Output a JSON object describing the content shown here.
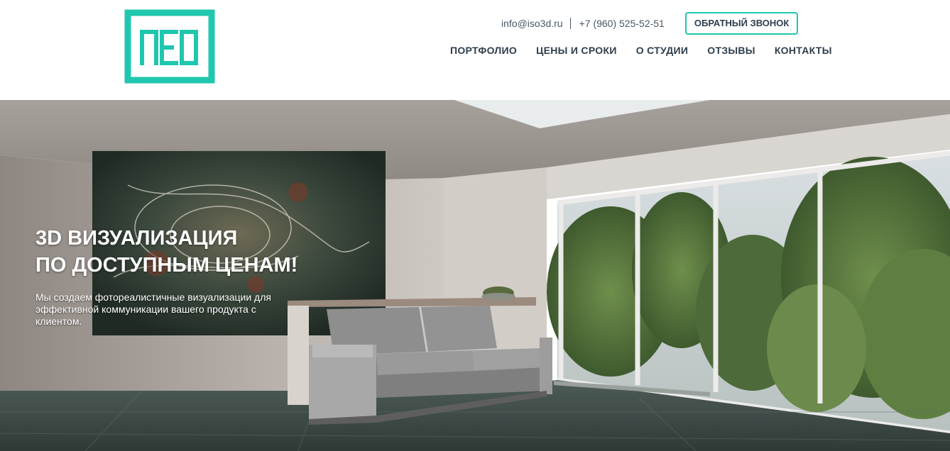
{
  "header": {
    "logo_alt": "ISO3D",
    "email": "info@iso3d.ru",
    "phone": "+7 (960) 525-52-51",
    "callback_label": "ОБРАТНЫЙ ЗВОНОК",
    "nav": [
      {
        "label": "ПОРТФОЛИО"
      },
      {
        "label": "ЦЕНЫ И СРОКИ"
      },
      {
        "label": "О СТУДИИ"
      },
      {
        "label": "ОТЗЫВЫ"
      },
      {
        "label": "КОНТАКТЫ"
      }
    ]
  },
  "hero": {
    "title_line1": "3D ВИЗУАЛИЗАЦИЯ",
    "title_line2": "ПО ДОСТУПНЫМ ЦЕНАМ!",
    "subtitle": "Мы создаем фотореалистичные визуализации для эффективной коммуникации вашего продукта с клиентом.",
    "background": "interior-render-sofa-window"
  },
  "colors": {
    "accent": "#1fc7ae",
    "text_dark": "#2f3e4c",
    "text_muted": "#4a5866"
  }
}
